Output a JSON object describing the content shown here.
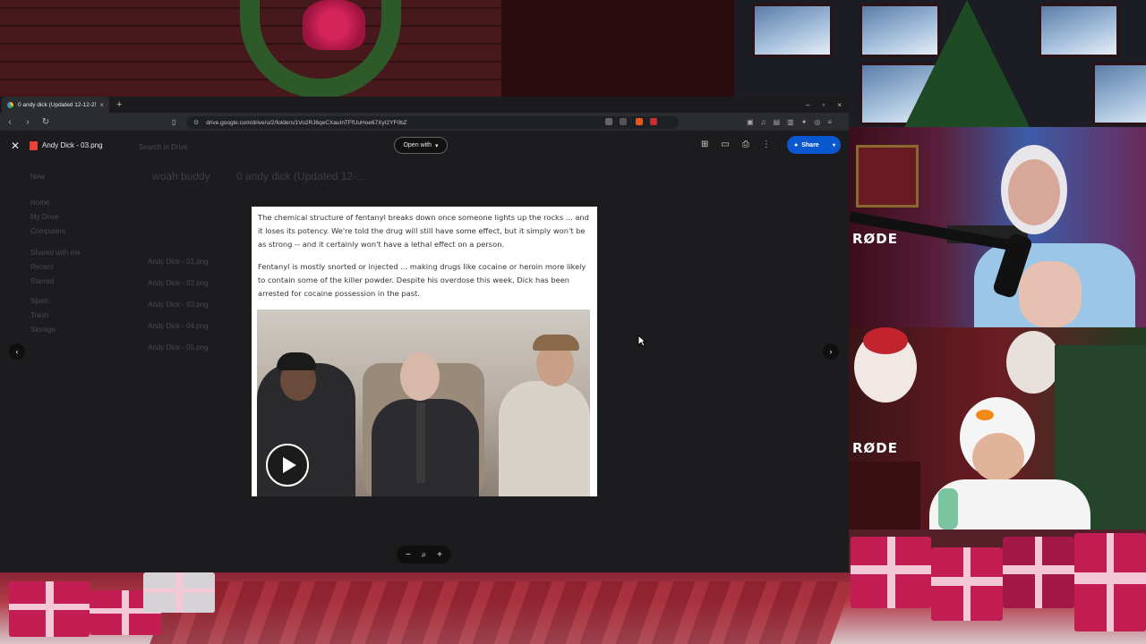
{
  "browser": {
    "tab_title": "0 andy dick (Updated 12-12-25)",
    "tab_close": "×",
    "new_tab": "+",
    "window_controls": [
      "–",
      "▫",
      "×"
    ],
    "url": "drive.google.com/drive/u/2/folders/1Vo2RJ6qeCXauInTFfUuHoe67XyI2YF0bZ",
    "nav": {
      "back": "‹",
      "forward": "›",
      "reload": "↻"
    }
  },
  "viewer": {
    "close": "✕",
    "file_name": "Andy Dick - 03.png",
    "open_with_label": "Open with",
    "share_label": "Share",
    "prev_arrow": "‹",
    "next_arrow": "›",
    "zoom_out": "−",
    "zoom_in": "+",
    "zoom_reset": "⌕"
  },
  "background_drive": {
    "breadcrumb_1": "woah buddy",
    "breadcrumb_2": "0 andy dick (Updated 12-...",
    "search_placeholder": "Search in Drive",
    "sidebar": [
      "New",
      "Home",
      "My Drive",
      "Computers",
      "Shared with me",
      "Recent",
      "Starred",
      "Spam",
      "Trash",
      "Storage"
    ],
    "files": [
      "Andy Dick - 01.png",
      "Andy Dick - 02.png",
      "Andy Dick - 03.png",
      "Andy Dick - 04.png",
      "Andy Dick - 05.png"
    ]
  },
  "document": {
    "paragraph_1": "The chemical structure of fentanyl breaks down once someone lights up the rocks ... and it loses its potency. We're told the drug will still have some effect, but it simply won't be as strong -- and it certainly won't have a lethal effect on a person.",
    "paragraph_2": "Fentanyl is mostly snorted or injected ... making drugs like cocaine or heroin more likely to contain some of the killer powder. Despite his overdose this week, Dick has been arrested for cocaine possession in the past."
  },
  "webcams": {
    "cam1_mic_brand": "RØDE",
    "cam2_mic_brand": "RØDE"
  },
  "colors": {
    "share_blue": "#0b57d0",
    "viewer_bg": "#1c1c1e",
    "festive_red": "#c21e54"
  }
}
